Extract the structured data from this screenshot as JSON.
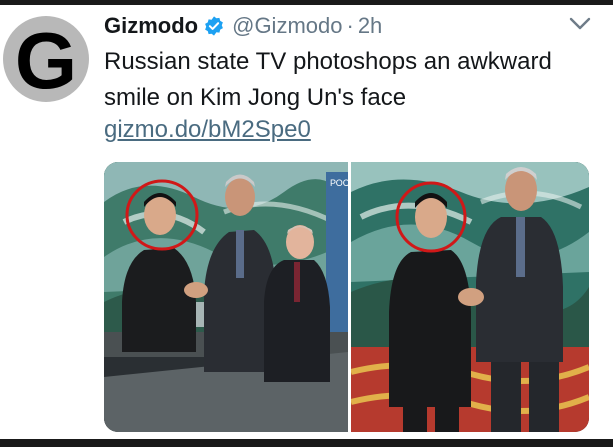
{
  "tweet": {
    "author_name": "Gizmodo",
    "handle": "@Gizmodo",
    "separator": "·",
    "time": "2h",
    "text": "Russian state TV photoshops an awkward smile on Kim Jong Un's face",
    "link": "gizmo.do/bM2Spe0",
    "avatar_letter": "G",
    "verified": true
  },
  "media": {
    "left_photo": {
      "tv_logo_text": "РОС"
    }
  },
  "colors": {
    "verified_blue": "#1da1f2",
    "link": "#4a6b80",
    "secondary_text": "#657786",
    "circle_red": "#d01818"
  },
  "icons": {
    "verified": "verified-badge-icon",
    "menu": "chevron-down-icon"
  }
}
